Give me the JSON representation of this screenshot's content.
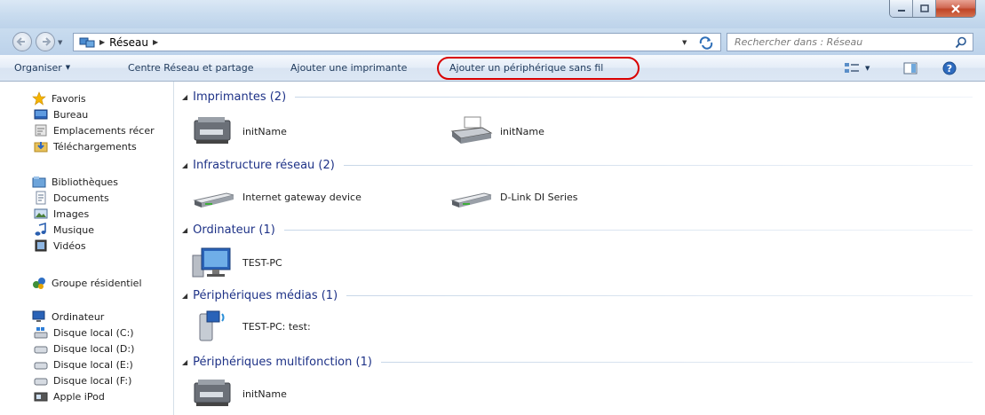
{
  "address": {
    "crumbs": [
      "Réseau"
    ]
  },
  "search": {
    "placeholder": "Rechercher dans : Réseau"
  },
  "commandbar": {
    "organize": "Organiser",
    "network_center": "Centre Réseau et partage",
    "add_printer": "Ajouter une imprimante",
    "add_wireless": "Ajouter un périphérique sans fil"
  },
  "sidebar": {
    "favorites": {
      "title": "Favoris",
      "items": [
        "Bureau",
        "Emplacements récer",
        "Téléchargements"
      ]
    },
    "libraries": {
      "title": "Bibliothèques",
      "items": [
        "Documents",
        "Images",
        "Musique",
        "Vidéos"
      ]
    },
    "homegroup": {
      "title": "Groupe résidentiel"
    },
    "computer": {
      "title": "Ordinateur",
      "items": [
        "Disque local (C:)",
        "Disque local (D:)",
        "Disque local (E:)",
        "Disque local (F:)",
        "Apple iPod"
      ]
    }
  },
  "groups": [
    {
      "title": "Imprimantes (2)",
      "items": [
        "initName",
        "initName"
      ]
    },
    {
      "title": "Infrastructure réseau (2)",
      "items": [
        "Internet gateway device",
        "D-Link DI Series"
      ]
    },
    {
      "title": "Ordinateur (1)",
      "items": [
        "TEST-PC"
      ]
    },
    {
      "title": "Périphériques médias (1)",
      "items": [
        "TEST-PC: test:"
      ]
    },
    {
      "title": "Périphériques multifonction (1)",
      "items": [
        "initName"
      ]
    }
  ],
  "colors": {
    "highlight_ring": "#d90000",
    "group_title": "#1e3287",
    "command_text": "#1e395b"
  }
}
